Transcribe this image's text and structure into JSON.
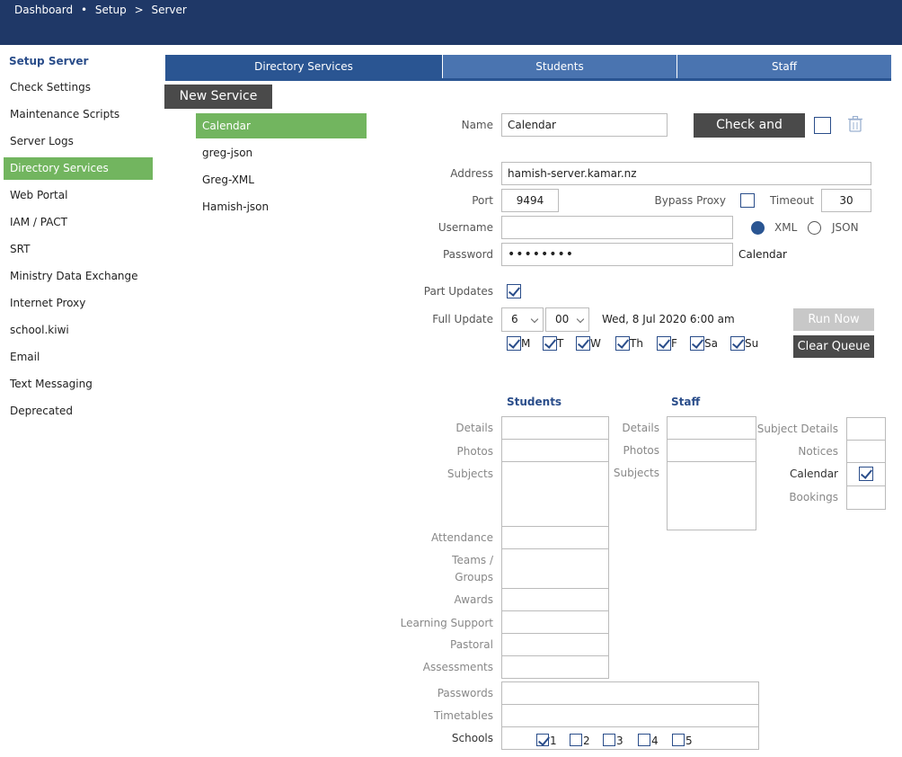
{
  "breadcrumb": {
    "item1": "Dashboard",
    "sep1": "•",
    "item2": "Setup",
    "sep2": ">",
    "item3": "Server"
  },
  "sidebar": {
    "title": "Setup Server",
    "items": [
      {
        "label": "Check Settings"
      },
      {
        "label": "Maintenance Scripts"
      },
      {
        "label": "Server Logs"
      },
      {
        "label": "Directory Services"
      },
      {
        "label": "Web Portal"
      },
      {
        "label": "IAM / PACT"
      },
      {
        "label": "SRT"
      },
      {
        "label": "Ministry Data Exchange"
      },
      {
        "label": "Internet Proxy"
      },
      {
        "label": "school.kiwi"
      },
      {
        "label": "Email"
      },
      {
        "label": "Text Messaging"
      },
      {
        "label": "Deprecated"
      }
    ],
    "active": "Directory Services"
  },
  "tabs": [
    {
      "label": "Directory Services"
    },
    {
      "label": "Students"
    },
    {
      "label": "Staff"
    }
  ],
  "new_service_label": "New Service",
  "services": [
    {
      "label": "Calendar"
    },
    {
      "label": "greg-json"
    },
    {
      "label": "Greg-XML"
    },
    {
      "label": "Hamish-json"
    }
  ],
  "form": {
    "name_label": "Name",
    "name_value": "Calendar",
    "check_enable_label": "Check and Enable",
    "address_label": "Address",
    "address_value": "hamish-server.kamar.nz",
    "port_label": "Port",
    "port_value": "9494",
    "bypass_label": "Bypass Proxy",
    "timeout_label": "Timeout",
    "timeout_value": "30",
    "username_label": "Username",
    "username_value": "",
    "xml_label": "XML",
    "json_label": "JSON",
    "password_label": "Password",
    "password_value": "••••••••",
    "password_note": "Calendar",
    "part_updates_label": "Part Updates",
    "full_update_label": "Full Update",
    "hour_value": "6",
    "minute_value": "00",
    "next_run": "Wed, 8 Jul 2020 6:00 am",
    "run_now_label": "Run Now",
    "clear_queue_label": "Clear Queue",
    "days": [
      {
        "label": "M"
      },
      {
        "label": "T"
      },
      {
        "label": "W"
      },
      {
        "label": "Th"
      },
      {
        "label": "F"
      },
      {
        "label": "Sa"
      },
      {
        "label": "Su"
      }
    ]
  },
  "students_header": "Students",
  "staff_header": "Staff",
  "student_fields": {
    "details": "Details",
    "photos": "Photos",
    "subjects": "Subjects",
    "attendance": "Attendance",
    "teams": "Teams /",
    "groups": "Groups",
    "awards": "Awards",
    "learning": "Learning Support",
    "pastoral": "Pastoral",
    "assessments": "Assessments",
    "passwords": "Passwords",
    "timetables": "Timetables",
    "schools": "Schools"
  },
  "staff_fields": {
    "details": "Details",
    "photos": "Photos",
    "subjects": "Subjects"
  },
  "other_fields": {
    "subject_details": "Subject Details",
    "notices": "Notices",
    "calendar": "Calendar",
    "bookings": "Bookings"
  },
  "schools": [
    {
      "label": "1",
      "checked": true
    },
    {
      "label": "2",
      "checked": false
    },
    {
      "label": "3",
      "checked": false
    },
    {
      "label": "4",
      "checked": false
    },
    {
      "label": "5",
      "checked": false
    }
  ]
}
